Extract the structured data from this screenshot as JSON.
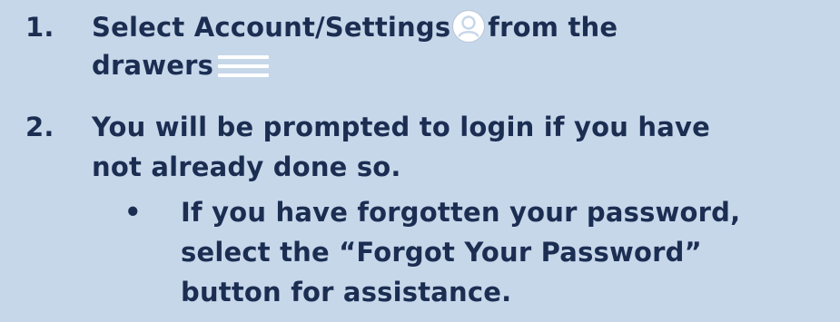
{
  "steps": [
    {
      "number": "1.",
      "line1_before": "Select Account/Settings",
      "line1_after": "from the",
      "line2": "drawers",
      "icon_account": "account-icon",
      "icon_drawers": "hamburger-menu-icon"
    },
    {
      "number": "2.",
      "line1": "You will be prompted to login if you have",
      "line2": "not already done so.",
      "bullet": {
        "symbol": "•",
        "line1": "If you have forgotten your password,",
        "line2": "select the “Forgot Your Password”",
        "line3": "button for assistance."
      }
    }
  ],
  "colors": {
    "background": "#c7d7ea",
    "text": "#1b2e52",
    "icon": "#ffffff"
  }
}
